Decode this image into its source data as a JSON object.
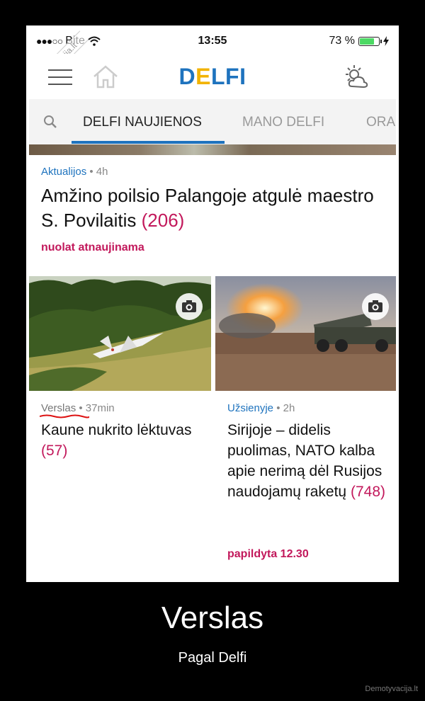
{
  "status": {
    "carrier": "Bite",
    "time": "13:55",
    "battery": "73 %",
    "battery_level": 0.73
  },
  "watermark": "Demotyvacija.lt",
  "appbar": {
    "logo_d": "D",
    "logo_e": "E",
    "logo_rest": "LFI"
  },
  "tabs": [
    "DELFI NAUJIENOS",
    "MANO DELFI",
    "ORA"
  ],
  "featured": {
    "category": "Aktualijos",
    "time": "4h",
    "title": "Amžino poilsio Palangoje atgulė maestro S. Povilaitis",
    "count": "(206)",
    "live": "nuolat atnaujinama"
  },
  "cards": [
    {
      "category": "Verslas",
      "time": "37min",
      "title": "Kaune nukrito lėktuvas",
      "count": "(57)"
    },
    {
      "category": "Užsienyje",
      "time": "2h",
      "title": "Sirijoje – didelis puolimas, NATO kalba apie nerimą dėl Rusijos naudojamų raketų",
      "count": "(748)",
      "updated": "papildyta 12.30"
    }
  ],
  "caption": {
    "title": "Verslas",
    "subtitle": "Pagal Delfi",
    "site": "Demotyvacija.lt"
  },
  "colors": {
    "accent": "#1e73be",
    "logo_yellow": "#f2b300",
    "comment_count": "#c2185b"
  }
}
